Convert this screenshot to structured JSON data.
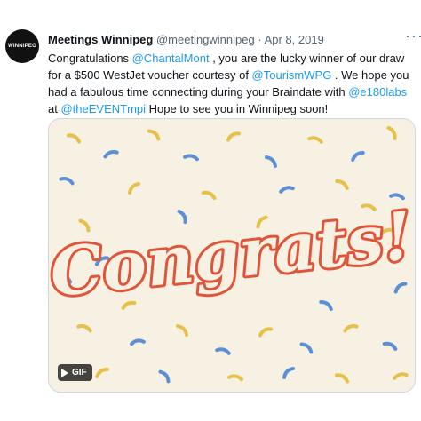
{
  "tweet": {
    "avatar_text": "WINNIPEG",
    "author_name": "Meetings Winnipeg",
    "handle": "@meetingwinnipeg",
    "separator": "·",
    "date": "Apr 8, 2019",
    "more": "···",
    "segments": [
      {
        "text": "Congratulations ",
        "mention": false
      },
      {
        "text": "@ChantalMont",
        "mention": true
      },
      {
        "text": " , you are the lucky winner of our draw for a $500 WestJet voucher courtesy of ",
        "mention": false
      },
      {
        "text": "@TourismWPG",
        "mention": true
      },
      {
        "text": " . We hope you had a fabulous time connecting during your Braindate with ",
        "mention": false
      },
      {
        "text": "@e180labs",
        "mention": true
      },
      {
        "text": " at ",
        "mention": false
      },
      {
        "text": "@theEVENTmpi",
        "mention": true
      },
      {
        "text": " Hope to see you in Winnipeg soon!",
        "mention": false
      }
    ],
    "media": {
      "word": "Congrats!",
      "badge": "GIF",
      "colors": {
        "lettering": "#e0553a",
        "confetti_yellow": "#e7c04a",
        "confetti_blue": "#5b8fd6",
        "background": "#f6f1e2"
      }
    }
  }
}
